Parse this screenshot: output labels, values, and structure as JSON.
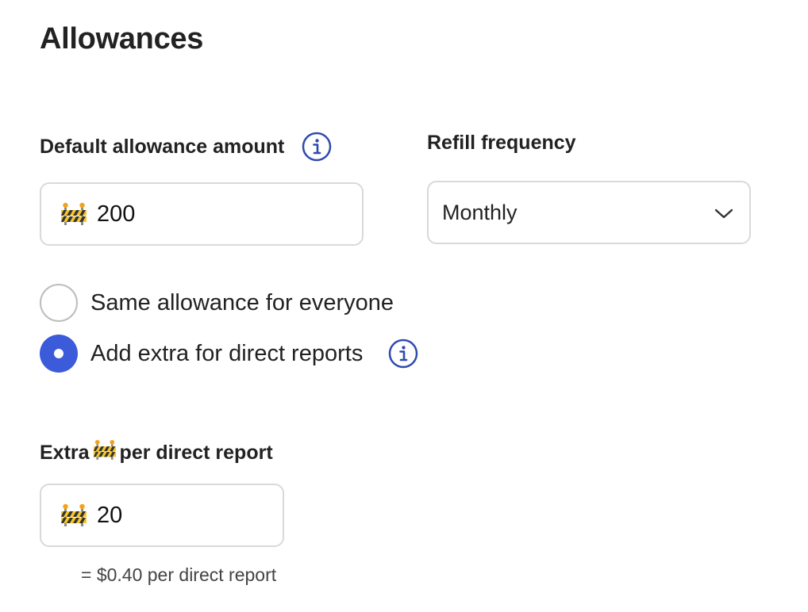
{
  "page": {
    "title": "Allowances"
  },
  "default_allowance": {
    "label": "Default allowance amount",
    "currency_icon": "construction-barrier-icon",
    "value": "200"
  },
  "refill_frequency": {
    "label": "Refill frequency",
    "selected": "Monthly"
  },
  "allowance_mode": {
    "options": [
      {
        "label": "Same allowance for everyone",
        "checked": false
      },
      {
        "label": "Add extra for direct reports",
        "checked": true
      }
    ]
  },
  "extra_per_report": {
    "label_prefix": "Extra",
    "label_suffix": "per direct report",
    "currency_icon": "construction-barrier-icon",
    "value": "20",
    "helper": "= $0.40 per direct report"
  },
  "colors": {
    "accent": "#3b5bdb",
    "info_icon": "#2f4ab0",
    "border": "#d9d9d9",
    "text": "#222222"
  }
}
